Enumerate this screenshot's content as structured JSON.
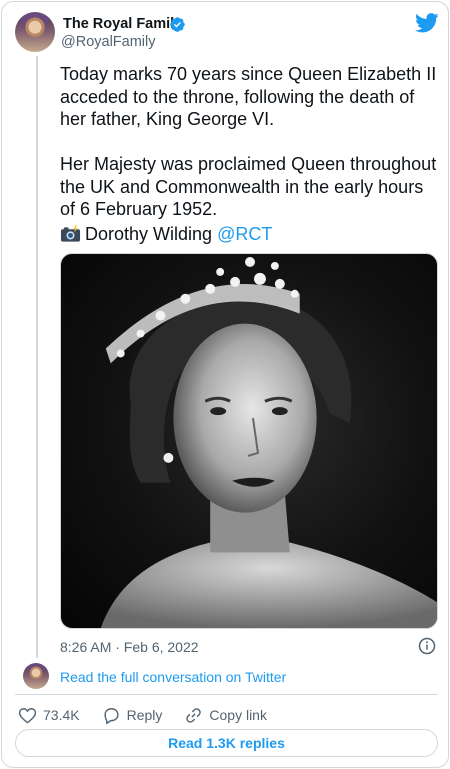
{
  "author": {
    "display_name": "The Royal Family",
    "handle": "@RoyalFamily",
    "verified_icon": "verified-badge-icon"
  },
  "tweet": {
    "paragraph_1": "Today marks 70 years since Queen Elizabeth II acceded to the throne, following the death of her father, King George VI.",
    "paragraph_2": "Her Majesty was proclaimed Queen throughout the UK and Commonwealth in the early hours of 6 February 1952.",
    "credit_emoji": "camera-with-flash-icon",
    "credit_name": "Dorothy Wilding",
    "credit_mention": "@RCT"
  },
  "meta": {
    "timestamp": "8:26 AM · Feb 6, 2022"
  },
  "conversation": {
    "link_text": "Read the full conversation on Twitter"
  },
  "actions": {
    "likes_count": "73.4K",
    "reply_label": "Reply",
    "copy_link_label": "Copy link"
  },
  "replies_button": {
    "label": "Read 1.3K replies"
  },
  "colors": {
    "accent": "#1d9bf0",
    "text_primary": "#0f1419",
    "text_secondary": "#536471",
    "border": "#cfd9de"
  }
}
